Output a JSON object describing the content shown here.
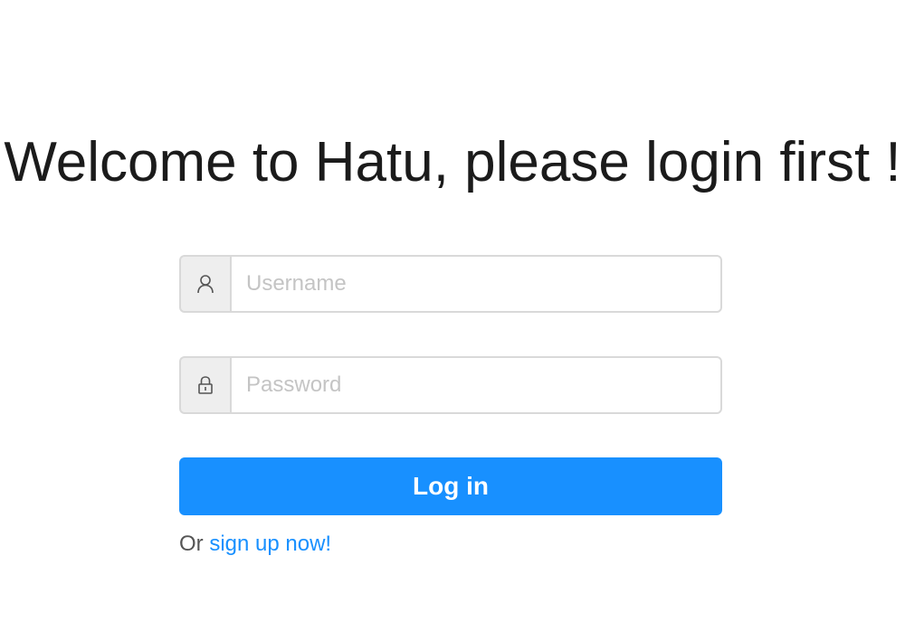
{
  "page": {
    "title": "Welcome to Hatu, please login first !"
  },
  "login_form": {
    "username": {
      "icon": "user-icon",
      "placeholder": "Username",
      "value": ""
    },
    "password": {
      "icon": "lock-icon",
      "placeholder": "Password",
      "value": ""
    },
    "submit_label": "Log in",
    "signup_prefix": "Or",
    "signup_link_text": "sign up now!"
  },
  "colors": {
    "primary": "#1890ff",
    "title_text": "#1b1b1b",
    "border": "#d9d9d9",
    "addon_bg": "#eeeeee",
    "placeholder": "#c4c4c4"
  }
}
